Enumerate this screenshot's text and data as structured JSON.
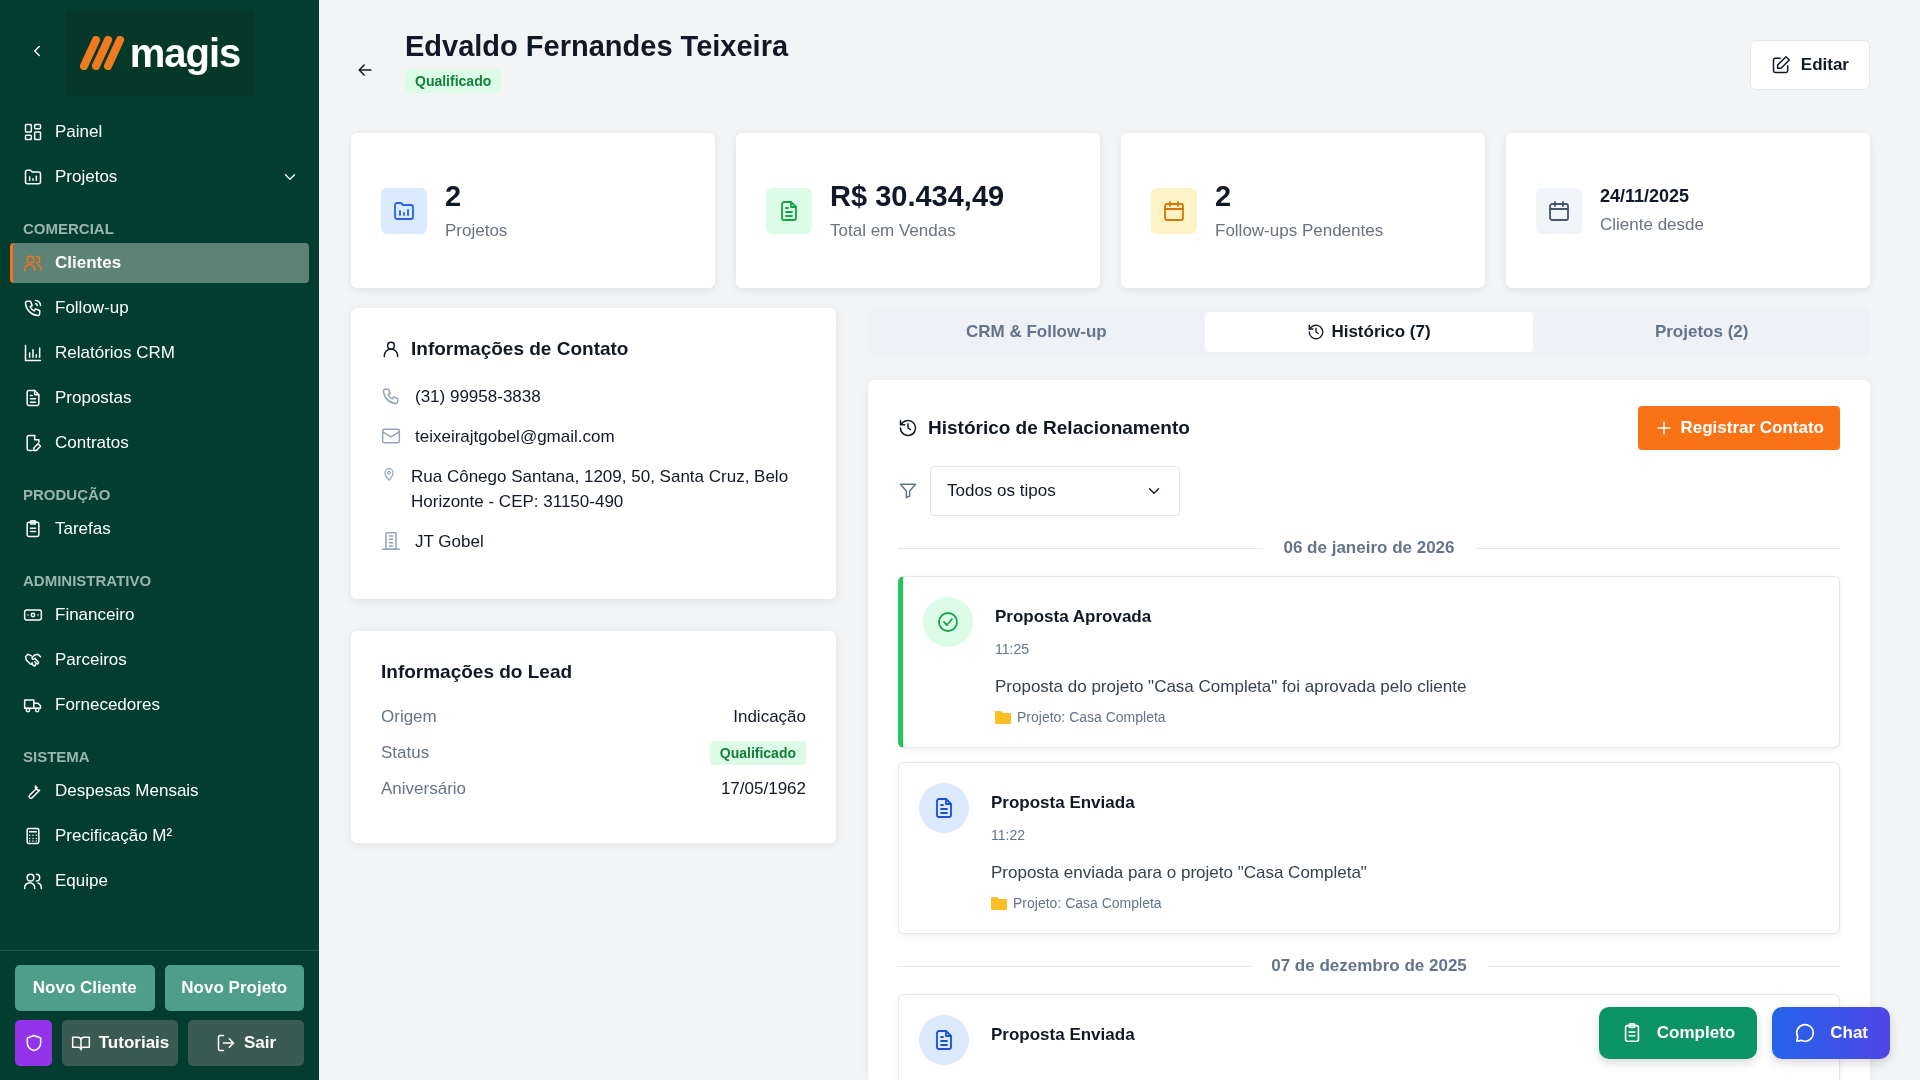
{
  "sidebar": {
    "logo": "magis",
    "top_items": [
      {
        "label": "Painel",
        "selected": false
      },
      {
        "label": "Projetos",
        "selected": false,
        "expanded": false
      }
    ],
    "sections": [
      {
        "title": "COMERCIAL",
        "items": [
          {
            "label": "Clientes",
            "selected": true
          },
          {
            "label": "Follow-up",
            "selected": false
          },
          {
            "label": "Relatórios CRM",
            "selected": false
          },
          {
            "label": "Propostas",
            "selected": false
          },
          {
            "label": "Contratos",
            "selected": false
          }
        ]
      },
      {
        "title": "PRODUÇÃO",
        "items": [
          {
            "label": "Tarefas",
            "selected": false
          }
        ]
      },
      {
        "title": "ADMINISTRATIVO",
        "items": [
          {
            "label": "Financeiro",
            "selected": false
          },
          {
            "label": "Parceiros",
            "selected": false
          },
          {
            "label": "Fornecedores",
            "selected": false
          }
        ]
      },
      {
        "title": "SISTEMA",
        "items": [
          {
            "label": "Despesas Mensais",
            "selected": false
          },
          {
            "label": "Precificação M²",
            "selected": false
          },
          {
            "label": "Equipe",
            "selected": false
          }
        ]
      }
    ],
    "actions": [
      "Novo Cliente",
      "Novo Projeto"
    ],
    "footer": [
      "Tutoriais",
      "Sair"
    ]
  },
  "header": {
    "title": "Edvaldo Fernandes Teixeira",
    "status": "Qualificado",
    "edit_button": "Editar"
  },
  "stats": [
    {
      "kind": "projects",
      "value": "2",
      "label": "Projetos"
    },
    {
      "kind": "sales",
      "value": "R$ 30.434,49",
      "label": "Total em Vendas"
    },
    {
      "kind": "followups",
      "value": "2",
      "label": "Follow-ups Pendentes"
    },
    {
      "kind": "since",
      "value": "24/11/2025",
      "label": "Cliente desde"
    }
  ],
  "contact": {
    "title": "Informações de Contato",
    "rows": [
      "(31) 99958-3838",
      "teixeirajtgobel@gmail.com",
      "Rua Cônego Santana, 1209, 50, Santa Cruz, Belo Horizonte - CEP: 31150-490",
      "JT Gobel"
    ]
  },
  "lead": {
    "title": "Informações do Lead",
    "rows": [
      {
        "kind": "text",
        "label": "Origem",
        "value": "Indicação"
      },
      {
        "kind": "badge",
        "label": "Status",
        "value": "Qualificado"
      },
      {
        "kind": "text",
        "label": "Aniversário",
        "value": "17/05/1962"
      }
    ]
  },
  "tabs": [
    {
      "label": "CRM & Follow-up",
      "selected": false
    },
    {
      "label": "Histórico (7)",
      "selected": true
    },
    {
      "label": "Projetos (2)",
      "selected": false
    }
  ],
  "history": {
    "title": "Histórico de Relacionamento",
    "add_button": "Registrar Contato",
    "filter": {
      "value": "Todos os tipos"
    },
    "groups": [
      {
        "date": "06 de janeiro de 2026",
        "events": [
          {
            "kind": "approved",
            "title": "Proposta Aprovada",
            "time": "11:25",
            "description": "Proposta do projeto \"Casa Completa\" foi aprovada pelo cliente",
            "project": "Projeto: Casa Completa"
          },
          {
            "kind": "sent",
            "title": "Proposta Enviada",
            "time": "11:22",
            "description": "Proposta enviada para o projeto \"Casa Completa\"",
            "project": "Projeto: Casa Completa"
          }
        ]
      },
      {
        "date": "07 de dezembro de 2025",
        "events": [
          {
            "kind": "sent",
            "title": "Proposta Enviada"
          }
        ]
      }
    ]
  },
  "floating": [
    "Completo",
    "Chat"
  ]
}
